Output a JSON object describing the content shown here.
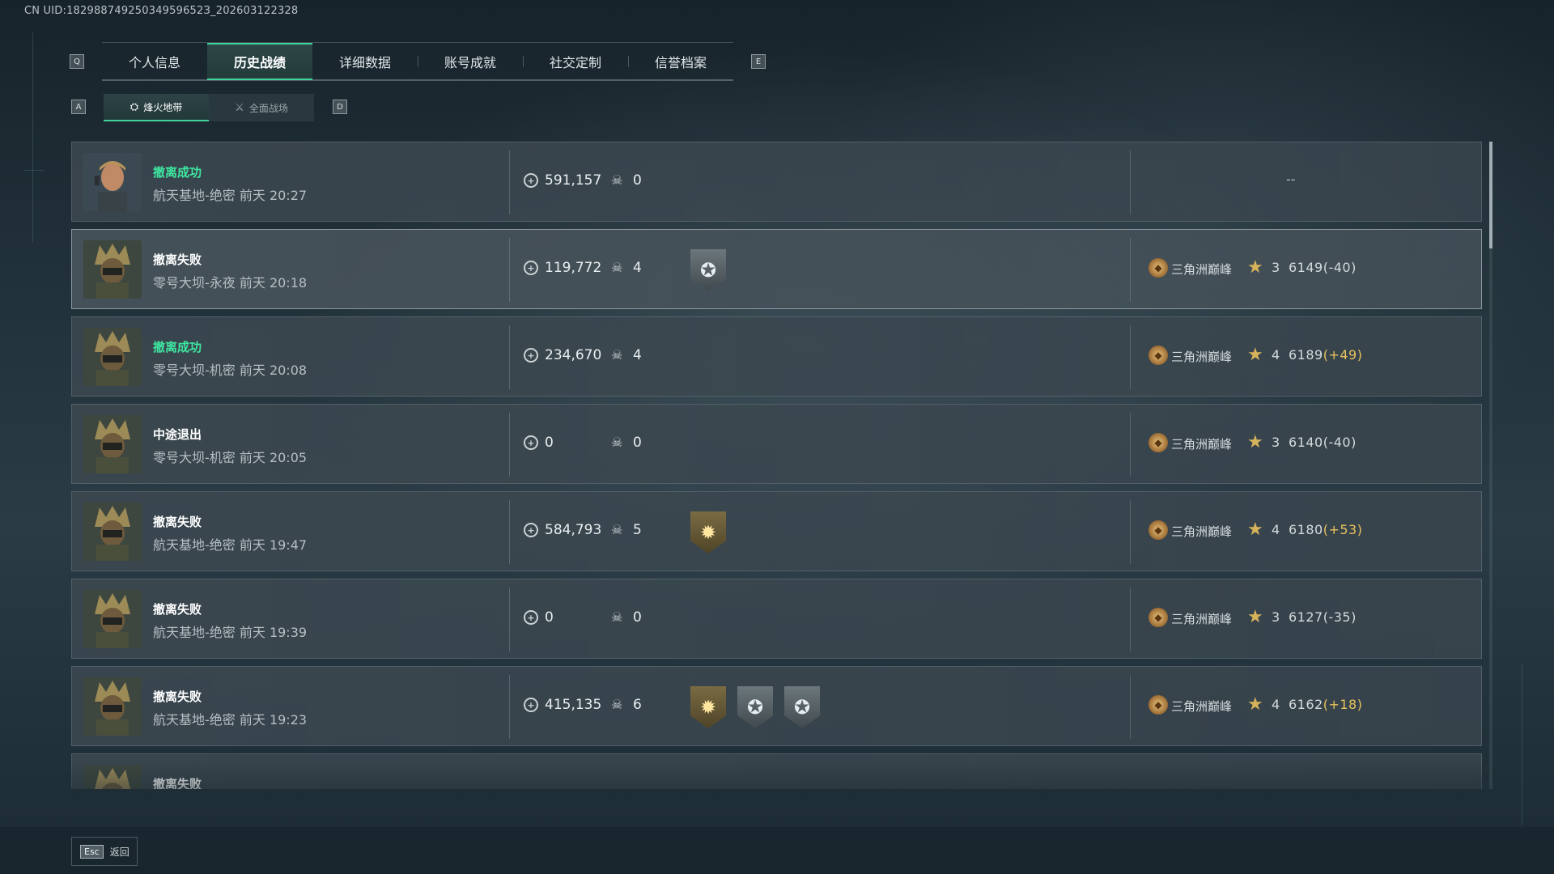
{
  "header": {
    "uid": "CN UID:18298874925034959652З_202603122328"
  },
  "tabs": {
    "left_key": "Q",
    "right_key": "E",
    "items": [
      {
        "label": "个人信息"
      },
      {
        "label": "历史战绩"
      },
      {
        "label": "详细数据"
      },
      {
        "label": "账号成就"
      },
      {
        "label": "社交定制"
      },
      {
        "label": "信誉档案"
      }
    ]
  },
  "subtabs": {
    "left_key": "A",
    "right_key": "D",
    "items": [
      {
        "label": "烽火地带",
        "icon": "fire-zone-icon"
      },
      {
        "label": "全面战场",
        "icon": "battlefield-icon"
      }
    ]
  },
  "matches": [
    {
      "status": "撤离成功",
      "result": "success",
      "map": "航天基地-绝密 前天 20:27",
      "value": "591,157",
      "kills": "0",
      "badges": [],
      "rank_text": "--"
    },
    {
      "status": "撤离失败",
      "result": "fail",
      "map": "零号大坝-永夜 前天 20:18",
      "value": "119,772",
      "kills": "4",
      "badges": [
        "grey"
      ],
      "rank": "三角洲巅峰",
      "stars": "3",
      "score": "6149",
      "delta": "(-40)",
      "delta_positive": false
    },
    {
      "status": "撤离成功",
      "result": "success",
      "map": "零号大坝-机密 前天 20:08",
      "value": "234,670",
      "kills": "4",
      "badges": [],
      "rank": "三角洲巅峰",
      "stars": "4",
      "score": "6189",
      "delta": "(+49)",
      "delta_positive": true
    },
    {
      "status": "中途退出",
      "result": "quit",
      "map": "零号大坝-机密 前天 20:05",
      "value": "0",
      "kills": "0",
      "badges": [],
      "rank": "三角洲巅峰",
      "stars": "3",
      "score": "6140",
      "delta": "(-40)",
      "delta_positive": false
    },
    {
      "status": "撤离失败",
      "result": "fail",
      "map": "航天基地-绝密 前天 19:47",
      "value": "584,793",
      "kills": "5",
      "badges": [
        "gold"
      ],
      "rank": "三角洲巅峰",
      "stars": "4",
      "score": "6180",
      "delta": "(+53)",
      "delta_positive": true
    },
    {
      "status": "撤离失败",
      "result": "fail",
      "map": "航天基地-绝密 前天 19:39",
      "value": "0",
      "kills": "0",
      "badges": [],
      "rank": "三角洲巅峰",
      "stars": "3",
      "score": "6127",
      "delta": "(-35)",
      "delta_positive": false
    },
    {
      "status": "撤离失败",
      "result": "fail",
      "map": "航天基地-绝密 前天 19:23",
      "value": "415,135",
      "kills": "6",
      "badges": [
        "gold",
        "grey",
        "grey"
      ],
      "rank": "三角洲巅峰",
      "stars": "4",
      "score": "6162",
      "delta": "(+18)",
      "delta_positive": true
    },
    {
      "status": "撤离失败",
      "result": "fail",
      "map": "",
      "value": "",
      "kills": "",
      "badges": [],
      "rank": "",
      "stars": "",
      "score": "",
      "delta": "",
      "delta_positive": true
    }
  ],
  "footer": {
    "esc_key": "Esc",
    "back_label": "返回"
  },
  "colors": {
    "accent": "#3fd39a",
    "success": "#3ee6a0",
    "positive_delta": "#e8c25d"
  }
}
